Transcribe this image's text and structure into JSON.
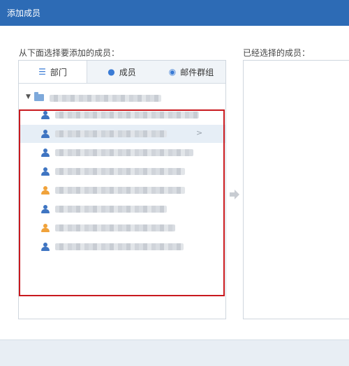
{
  "dialog": {
    "title": "添加成员"
  },
  "labels": {
    "left": "从下面选择要添加的成员：",
    "right": "已经选择的成员："
  },
  "tabs": [
    {
      "label": "部门",
      "icon": "list-icon"
    },
    {
      "label": "成员",
      "icon": "person-icon"
    },
    {
      "label": "邮件群组",
      "icon": "mail-group-icon"
    }
  ],
  "tree": {
    "department": {
      "icon": "folder-icon",
      "expanded": true
    },
    "members": [
      {
        "icon_color": "blue",
        "highlighted": false
      },
      {
        "icon_color": "blue",
        "highlighted": true,
        "arrow": ">"
      },
      {
        "icon_color": "blue",
        "highlighted": false
      },
      {
        "icon_color": "blue",
        "highlighted": false
      },
      {
        "icon_color": "orange",
        "highlighted": false
      },
      {
        "icon_color": "blue",
        "highlighted": false
      },
      {
        "icon_color": "orange",
        "highlighted": false
      },
      {
        "icon_color": "blue",
        "highlighted": false
      }
    ]
  },
  "colors": {
    "titlebar": "#2d6bb5",
    "highlight": "#c8191e"
  }
}
